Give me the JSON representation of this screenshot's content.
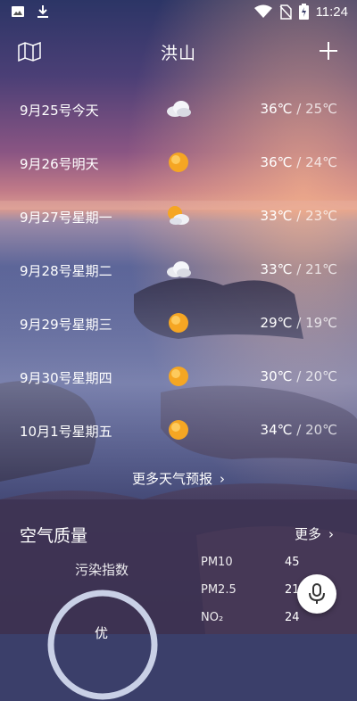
{
  "status_bar": {
    "time": "11:24",
    "icons": [
      "image-icon",
      "download-icon",
      "wifi-icon",
      "no-sim-icon",
      "battery-charging-icon"
    ]
  },
  "header": {
    "city": "洪山",
    "left_icon": "map-icon",
    "right_icon": "add-icon"
  },
  "forecast": [
    {
      "date": "9月25号今天",
      "icon": "cloudy-icon",
      "high": "36℃",
      "sep": " / ",
      "low": "25℃"
    },
    {
      "date": "9月26号明天",
      "icon": "sunny-icon",
      "high": "36℃",
      "sep": " / ",
      "low": "24℃"
    },
    {
      "date": "9月27号星期一",
      "icon": "partly-cloudy-icon",
      "high": "33℃",
      "sep": " / ",
      "low": "23℃"
    },
    {
      "date": "9月28号星期二",
      "icon": "cloudy-icon",
      "high": "33℃",
      "sep": " / ",
      "low": "21℃"
    },
    {
      "date": "9月29号星期三",
      "icon": "sunny-icon",
      "high": "29℃",
      "sep": " / ",
      "low": "19℃"
    },
    {
      "date": "9月30号星期四",
      "icon": "sunny-icon",
      "high": "30℃",
      "sep": " / ",
      "low": "20℃"
    },
    {
      "date": "10月1号星期五",
      "icon": "sunny-icon",
      "high": "34℃",
      "sep": " / ",
      "low": "20℃"
    }
  ],
  "more_forecast_label": "更多天气预报",
  "air_quality": {
    "title": "空气质量",
    "more_label": "更多",
    "index_label": "污染指数",
    "level": "优",
    "pollutants": [
      {
        "name": "PM10",
        "value": "45"
      },
      {
        "name": "PM2.5",
        "value": "21"
      },
      {
        "name": "NO₂",
        "value": "24"
      }
    ]
  },
  "colors": {
    "accent_sun": "#f5a623",
    "gauge_track": "#c9d0e6"
  }
}
